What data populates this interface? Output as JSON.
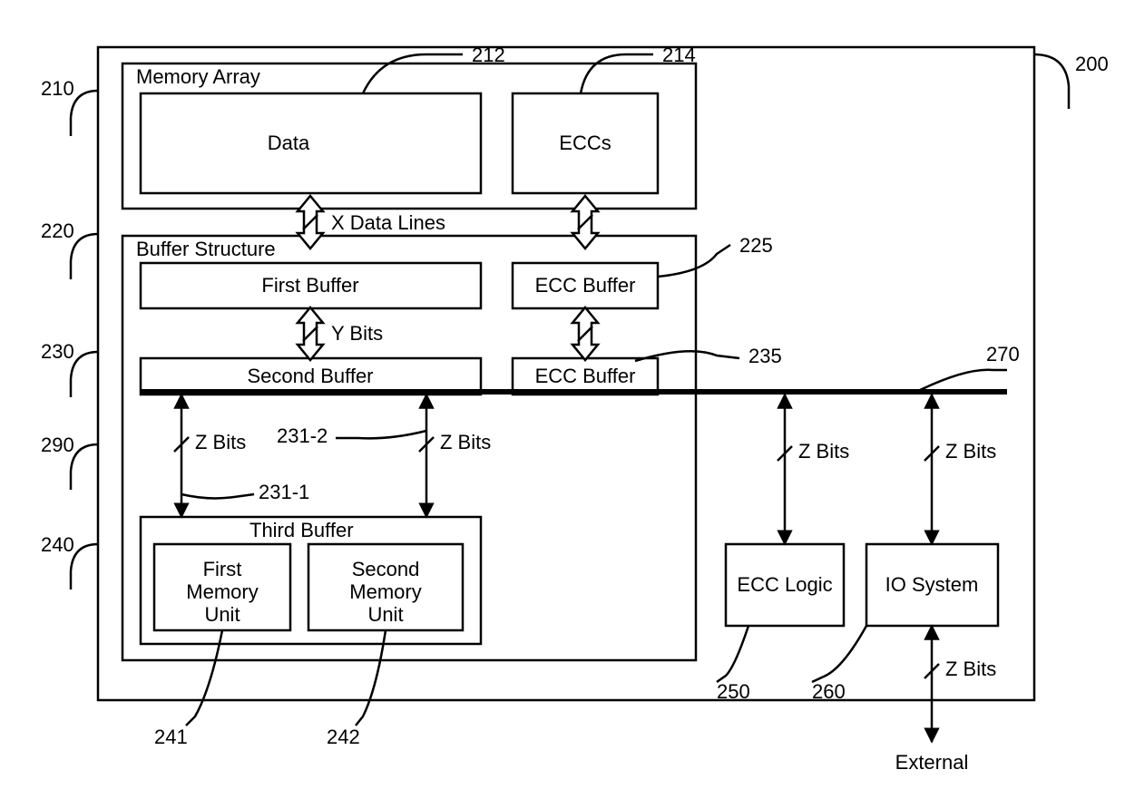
{
  "refs": {
    "outer": "200",
    "memory_array": "210",
    "data_block": "212",
    "eccs_block": "214",
    "buffer_structure": "220",
    "ecc_buffer1": "225",
    "second_buffer": "230",
    "ecc_buffer2": "235",
    "third_buffer": "240",
    "first_mem_unit": "241",
    "second_mem_unit": "242",
    "ecc_logic": "250",
    "io_system": "260",
    "bus": "270",
    "bottom_arrow_left_leader": "290",
    "leader_231_1": "231-1",
    "leader_231_2": "231-2"
  },
  "labels": {
    "memory_array": "Memory Array",
    "data": "Data",
    "eccs": "ECCs",
    "buffer_structure": "Buffer Structure",
    "first_buffer": "First Buffer",
    "second_buffer": "Second Buffer",
    "ecc_buffer": "ECC Buffer",
    "third_buffer": "Third Buffer",
    "first_mem_unit": "First Memory Unit",
    "second_mem_unit": "Second Memory Unit",
    "ecc_logic": "ECC Logic",
    "io_system": "IO System",
    "external": "External",
    "x_data_lines": "X Data Lines",
    "y_bits": "Y Bits",
    "z_bits": "Z Bits"
  }
}
